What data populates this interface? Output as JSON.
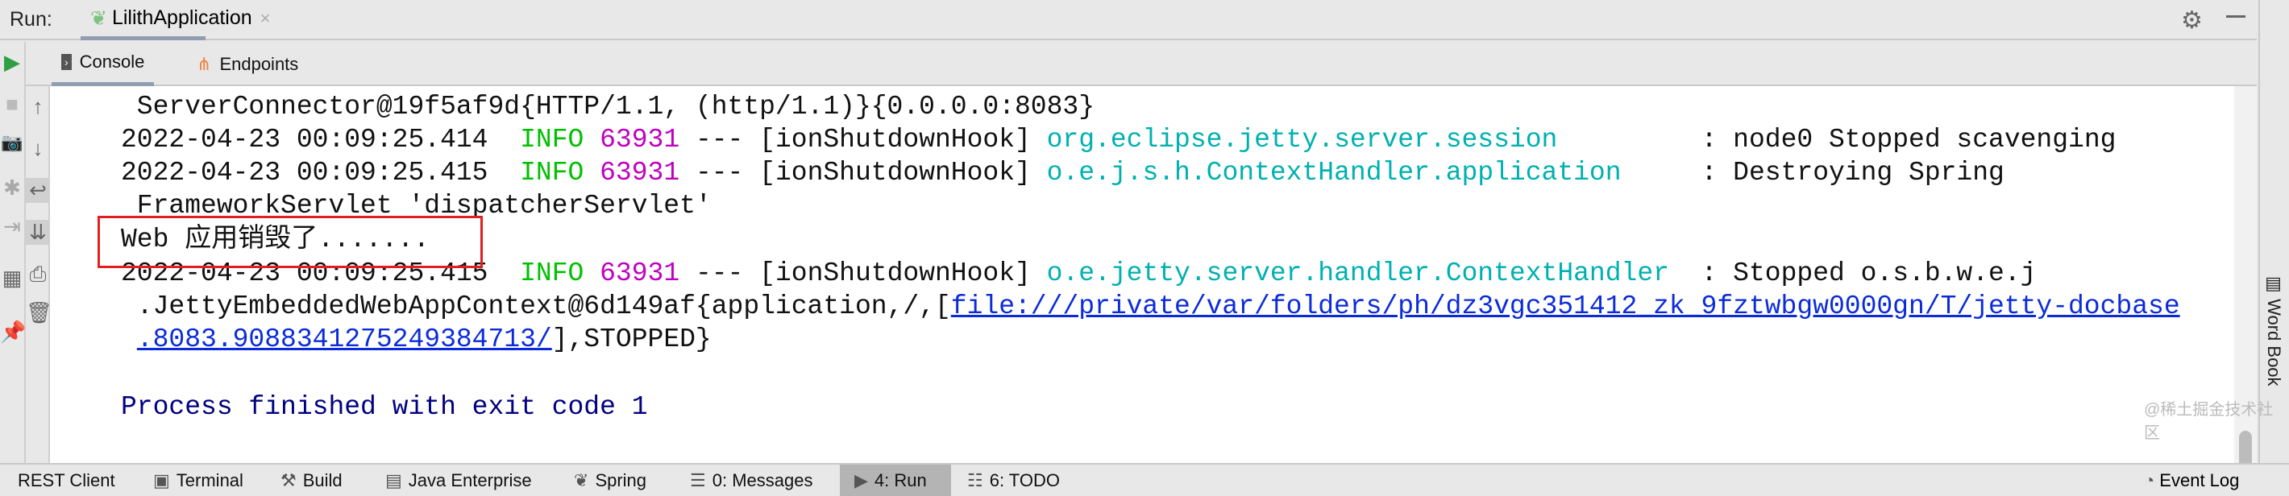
{
  "topbar": {
    "run_label": "Run:",
    "tab_title": "LilithApplication"
  },
  "subtabs": [
    {
      "label": "Console"
    },
    {
      "label": "Endpoints"
    }
  ],
  "console": {
    "lines": [
      {
        "text": " ServerConnector@19f5af9d{HTTP/1.1, (http/1.1)}{0.0.0.0:8083}"
      },
      {
        "ts": "2022-04-23 00:09:25.414  ",
        "level": "INFO",
        "pid": " 63931",
        "sep": " --- [ionShutdownHook] ",
        "logger": "org.eclipse.jetty.server.session        ",
        "msg": " : node0 Stopped scavenging"
      },
      {
        "ts": "2022-04-23 00:09:25.415  ",
        "level": "INFO",
        "pid": " 63931",
        "sep": " --- [ionShutdownHook] ",
        "logger": "o.e.j.s.h.ContextHandler.application    ",
        "msg": " : Destroying Spring"
      },
      {
        "text": " FrameworkServlet 'dispatcherServlet'"
      },
      {
        "text": "Web 应用销毁了......."
      },
      {
        "ts": "2022-04-23 00:09:25.415  ",
        "level": "INFO",
        "pid": " 63931",
        "sep": " --- [ionShutdownHook] ",
        "logger": "o.e.jetty.server.handler.ContextHandler ",
        "msg": " : Stopped o.s.b.w.e.j"
      },
      {
        "pre": " .JettyEmbeddedWebAppContext@6d149af{application,/,[",
        "link": "file:///private/var/folders/ph/dz3vgc351412_zk_9fztwbgw0000gn/T/jetty-docbase"
      },
      {
        "pre": " ",
        "link": ".8083.9088341275249384713/",
        "post": "],STOPPED}"
      },
      {
        "text": "Process finished with exit code 1"
      }
    ]
  },
  "rightstripe": {
    "word_book": "Word Book"
  },
  "bottom": {
    "tabs": [
      {
        "label": "REST Client",
        "icon": "rest-icon"
      },
      {
        "label": "Terminal",
        "icon": "terminal-icon"
      },
      {
        "label": "Build",
        "icon": "build-icon"
      },
      {
        "label": "Java Enterprise",
        "icon": "java-ee-icon"
      },
      {
        "label": "Spring",
        "icon": "spring-icon"
      },
      {
        "label": "0: Messages",
        "icon": "messages-icon"
      },
      {
        "label": "4: Run",
        "icon": "run-icon"
      },
      {
        "label": "6: TODO",
        "icon": "todo-icon"
      }
    ],
    "event_log": "Event Log",
    "watermark": "@稀土掘金技术社区"
  },
  "colors": {
    "info": "#00c000",
    "pid": "#c000c0",
    "logger": "#00b0b0",
    "link": "#0b2bdb",
    "exit": "#000080",
    "highlight_box": "#e02020"
  }
}
